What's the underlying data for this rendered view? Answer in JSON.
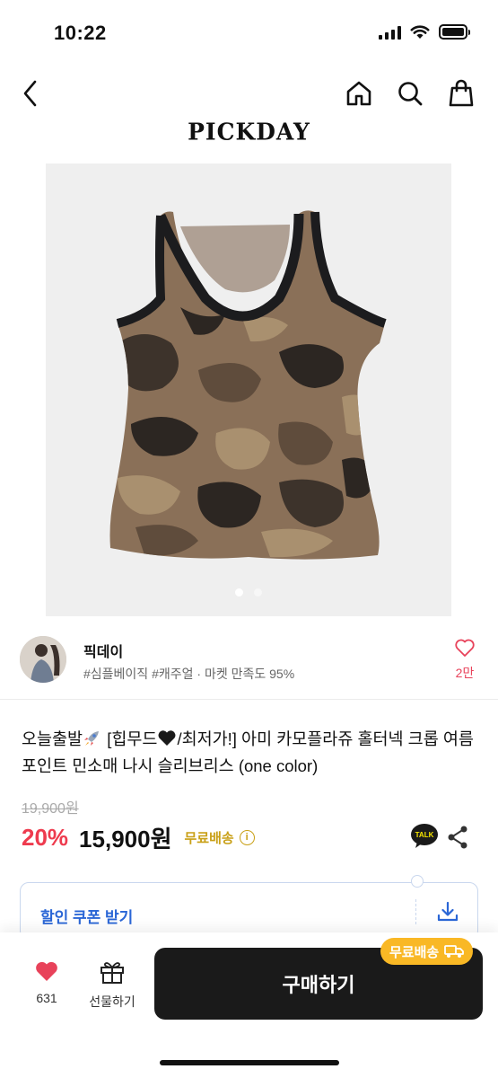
{
  "status": {
    "time": "10:22"
  },
  "nav": {
    "brand": "PICKDAY"
  },
  "seller": {
    "name": "픽데이",
    "tags": "#심플베이직 #캐주얼 · 마켓 만족도 95%",
    "likes": "2만"
  },
  "product": {
    "title_part1": "오늘출발",
    "title_part2": " [힙무드",
    "title_part3": "/최저가!] 아미 카모플라쥬 홀터넥 크롭 여름 포인트 민소매 나시 슬리브리스 (one color)",
    "original_price": "19,900원",
    "discount": "20%",
    "price": "15,900원",
    "shipping_label": "무료배송",
    "image_count": 2,
    "image_index": 1
  },
  "coupon": {
    "label": "할인 쿠폰 받기"
  },
  "bottom": {
    "wish_count": "631",
    "gift_label": "선물하기",
    "buy_label": "구매하기",
    "badge_label": "무료배송"
  },
  "colors": {
    "accent_red": "#ee3b4e",
    "gold": "#c9a017",
    "coupon_blue": "#2a66d6",
    "buy_bg": "#1a1a1a",
    "badge_yellow": "#f9b825"
  },
  "icons": [
    "back-icon",
    "home-icon",
    "search-icon",
    "bag-icon",
    "heart-icon",
    "info-icon",
    "kakao-talk-icon",
    "share-icon",
    "download-icon",
    "gift-icon",
    "truck-icon",
    "rocket-icon",
    "black-heart-icon"
  ]
}
